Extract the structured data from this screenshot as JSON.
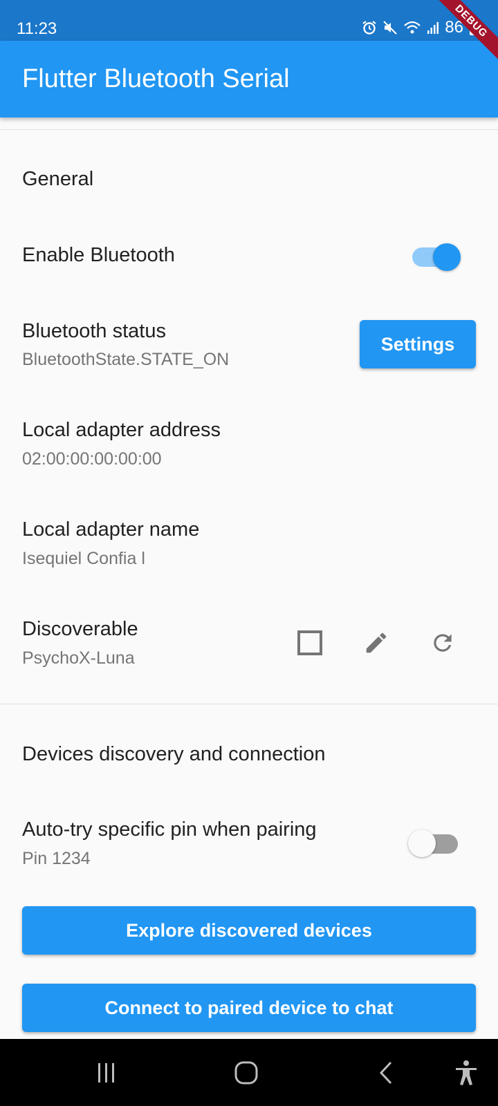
{
  "status_bar": {
    "time": "11:23",
    "battery": "86",
    "icons": [
      "alarm-icon",
      "mute-icon",
      "wifi-icon",
      "signal-icon",
      "battery-charging-icon"
    ]
  },
  "debug_banner": "DEBUG",
  "app_bar": {
    "title": "Flutter Bluetooth Serial"
  },
  "general": {
    "header": "General",
    "enable_bluetooth": {
      "label": "Enable Bluetooth",
      "on": true
    },
    "bluetooth_status": {
      "label": "Bluetooth status",
      "value": "BluetoothState.STATE_ON",
      "button": "Settings"
    },
    "local_address": {
      "label": "Local adapter address",
      "value": "02:00:00:00:00:00"
    },
    "local_name": {
      "label": "Local adapter name",
      "value": "Isequiel Confia l"
    },
    "discoverable": {
      "label": "Discoverable",
      "value": "PsychoX-Luna",
      "checked": false,
      "icons": [
        "checkbox-icon",
        "edit-icon",
        "refresh-icon"
      ]
    }
  },
  "devices": {
    "header": "Devices discovery and connection",
    "auto_pin": {
      "label": "Auto-try specific pin when pairing",
      "value": "Pin 1234",
      "on": false
    },
    "explore_button": "Explore discovered devices",
    "connect_button": "Connect to paired device to chat"
  },
  "nav_bar": {
    "icons": [
      "recent-apps-icon",
      "home-icon",
      "back-icon",
      "accessibility-icon"
    ]
  },
  "colors": {
    "primary": "#2196f3",
    "status_bar": "#1b77c9",
    "switch_track_on": "#90caf9",
    "switch_track_off": "#9e9e9e",
    "banner": "#a3132c"
  }
}
